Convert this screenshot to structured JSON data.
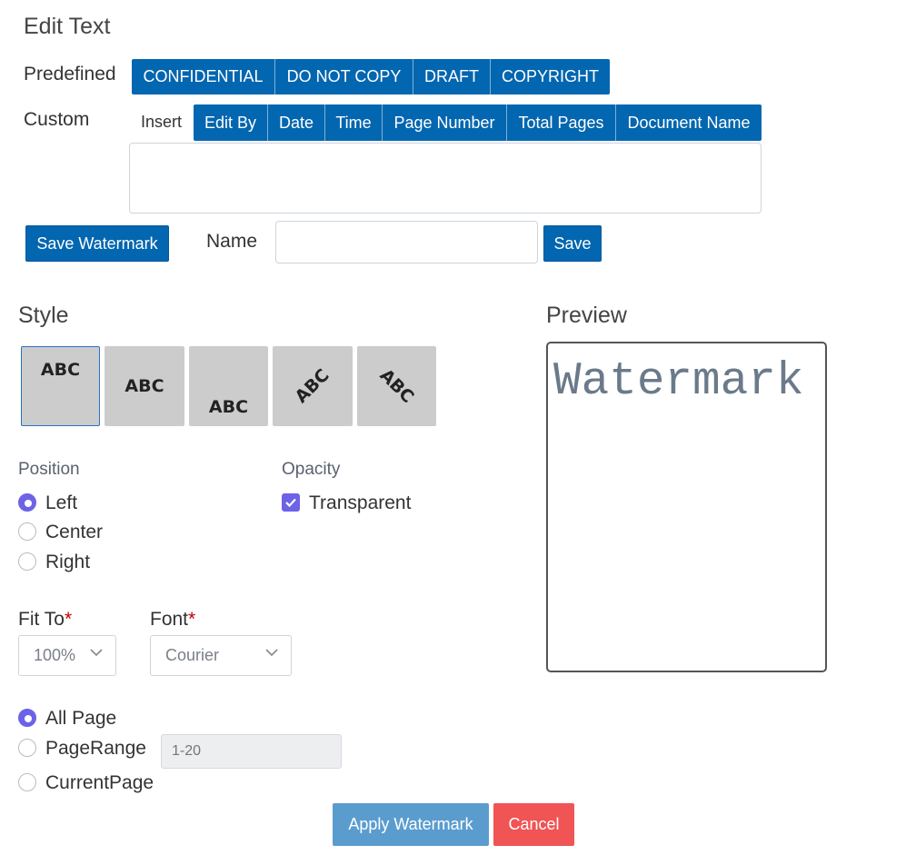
{
  "title": "Edit Text",
  "predefined": {
    "label": "Predefined",
    "buttons": [
      "CONFIDENTIAL",
      "DO NOT COPY",
      "DRAFT",
      "COPYRIGHT"
    ]
  },
  "custom": {
    "label": "Custom",
    "insert_label": "Insert",
    "insert_buttons": [
      "Edit By",
      "Date",
      "Time",
      "Page Number",
      "Total Pages",
      "Document Name"
    ],
    "text_value": ""
  },
  "save_watermark_button": "Save Watermark",
  "name_field": {
    "label": "Name",
    "value": ""
  },
  "save_button": "Save",
  "style": {
    "heading": "Style",
    "tiles": [
      "ABC",
      "ABC",
      "ABC",
      "ABC",
      "ABC"
    ],
    "selected_index": 0
  },
  "position": {
    "heading": "Position",
    "options": [
      "Left",
      "Center",
      "Right"
    ],
    "selected": "Left"
  },
  "opacity": {
    "heading": "Opacity",
    "checkbox_label": "Transparent",
    "checked": true
  },
  "fit_to": {
    "label": "Fit To",
    "required_mark": "*",
    "value": "100%"
  },
  "font": {
    "label": "Font",
    "required_mark": "*",
    "value": "Courier"
  },
  "pages": {
    "options": [
      "All Page",
      "PageRange",
      "CurrentPage"
    ],
    "selected": "All Page",
    "range_placeholder": "1-20"
  },
  "apply_button": "Apply Watermark",
  "cancel_button": "Cancel",
  "preview": {
    "heading": "Preview",
    "text": "Watermark"
  },
  "colors": {
    "primary": "#0366b0",
    "accent": "#6c63e8",
    "apply": "#5b9ccf",
    "cancel": "#f05454"
  }
}
